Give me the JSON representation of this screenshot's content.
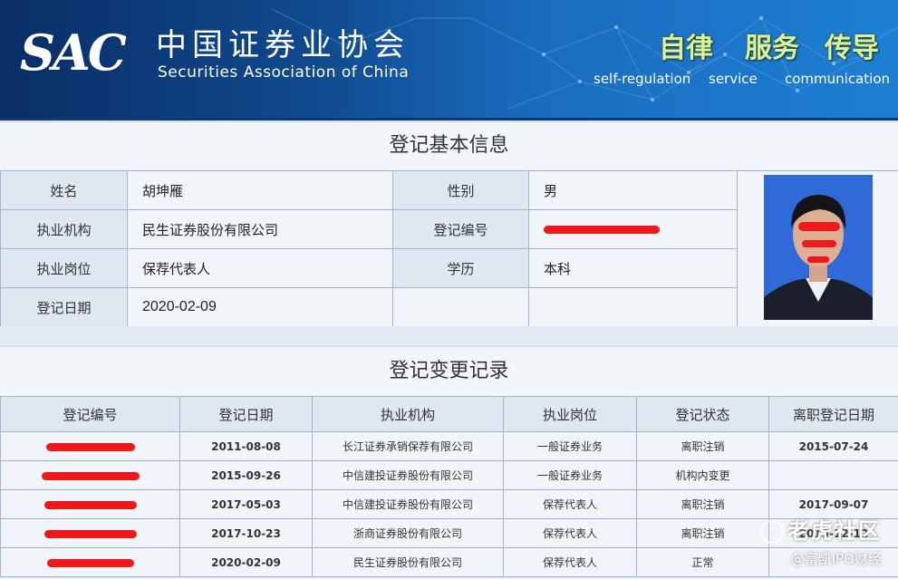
{
  "header": {
    "logo_abbr": "SAC",
    "logo_cn": "中国证券业协会",
    "logo_en": "Securities Association of China",
    "slogans": [
      {
        "cn": "自律",
        "en": "self-regulation"
      },
      {
        "cn": "服务",
        "en": "service"
      },
      {
        "cn": "传导",
        "en": "communication"
      }
    ]
  },
  "basic_info": {
    "title": "登记基本信息",
    "name_label": "姓名",
    "name": "胡坤雁",
    "gender_label": "性别",
    "gender": "男",
    "org_label": "执业机构",
    "org": "民生证券股份有限公司",
    "reg_no_label": "登记编号",
    "position_label": "执业岗位",
    "position": "保荐代表人",
    "education_label": "学历",
    "education": "本科",
    "reg_date_label": "登记日期",
    "reg_date": "2020-02-09"
  },
  "history": {
    "title": "登记变更记录",
    "columns": [
      "登记编号",
      "登记日期",
      "执业机构",
      "执业岗位",
      "登记状态",
      "离职登记日期"
    ],
    "rows": [
      {
        "date": "2011-08-08",
        "org": "长江证券承销保荐有限公司",
        "position": "一般证券业务",
        "status": "离职注销",
        "leave_date": "2015-07-24"
      },
      {
        "date": "2015-09-26",
        "org": "中信建投证券股份有限公司",
        "position": "一般证券业务",
        "status": "机构内变更",
        "leave_date": ""
      },
      {
        "date": "2017-05-03",
        "org": "中信建投证券股份有限公司",
        "position": "保荐代表人",
        "status": "离职注销",
        "leave_date": "2017-09-07"
      },
      {
        "date": "2017-10-23",
        "org": "浙商证券股份有限公司",
        "position": "保荐代表人",
        "status": "离职注销",
        "leave_date": "2019-12-12"
      },
      {
        "date": "2020-02-09",
        "org": "民生证券股份有限公司",
        "position": "保荐代表人",
        "status": "正常",
        "leave_date": ""
      }
    ]
  },
  "watermarks": {
    "community": "老虎社区",
    "source": "@富凯IPO财经"
  },
  "colors": {
    "redaction": "#f01818",
    "header_blue": "#104a8e"
  }
}
